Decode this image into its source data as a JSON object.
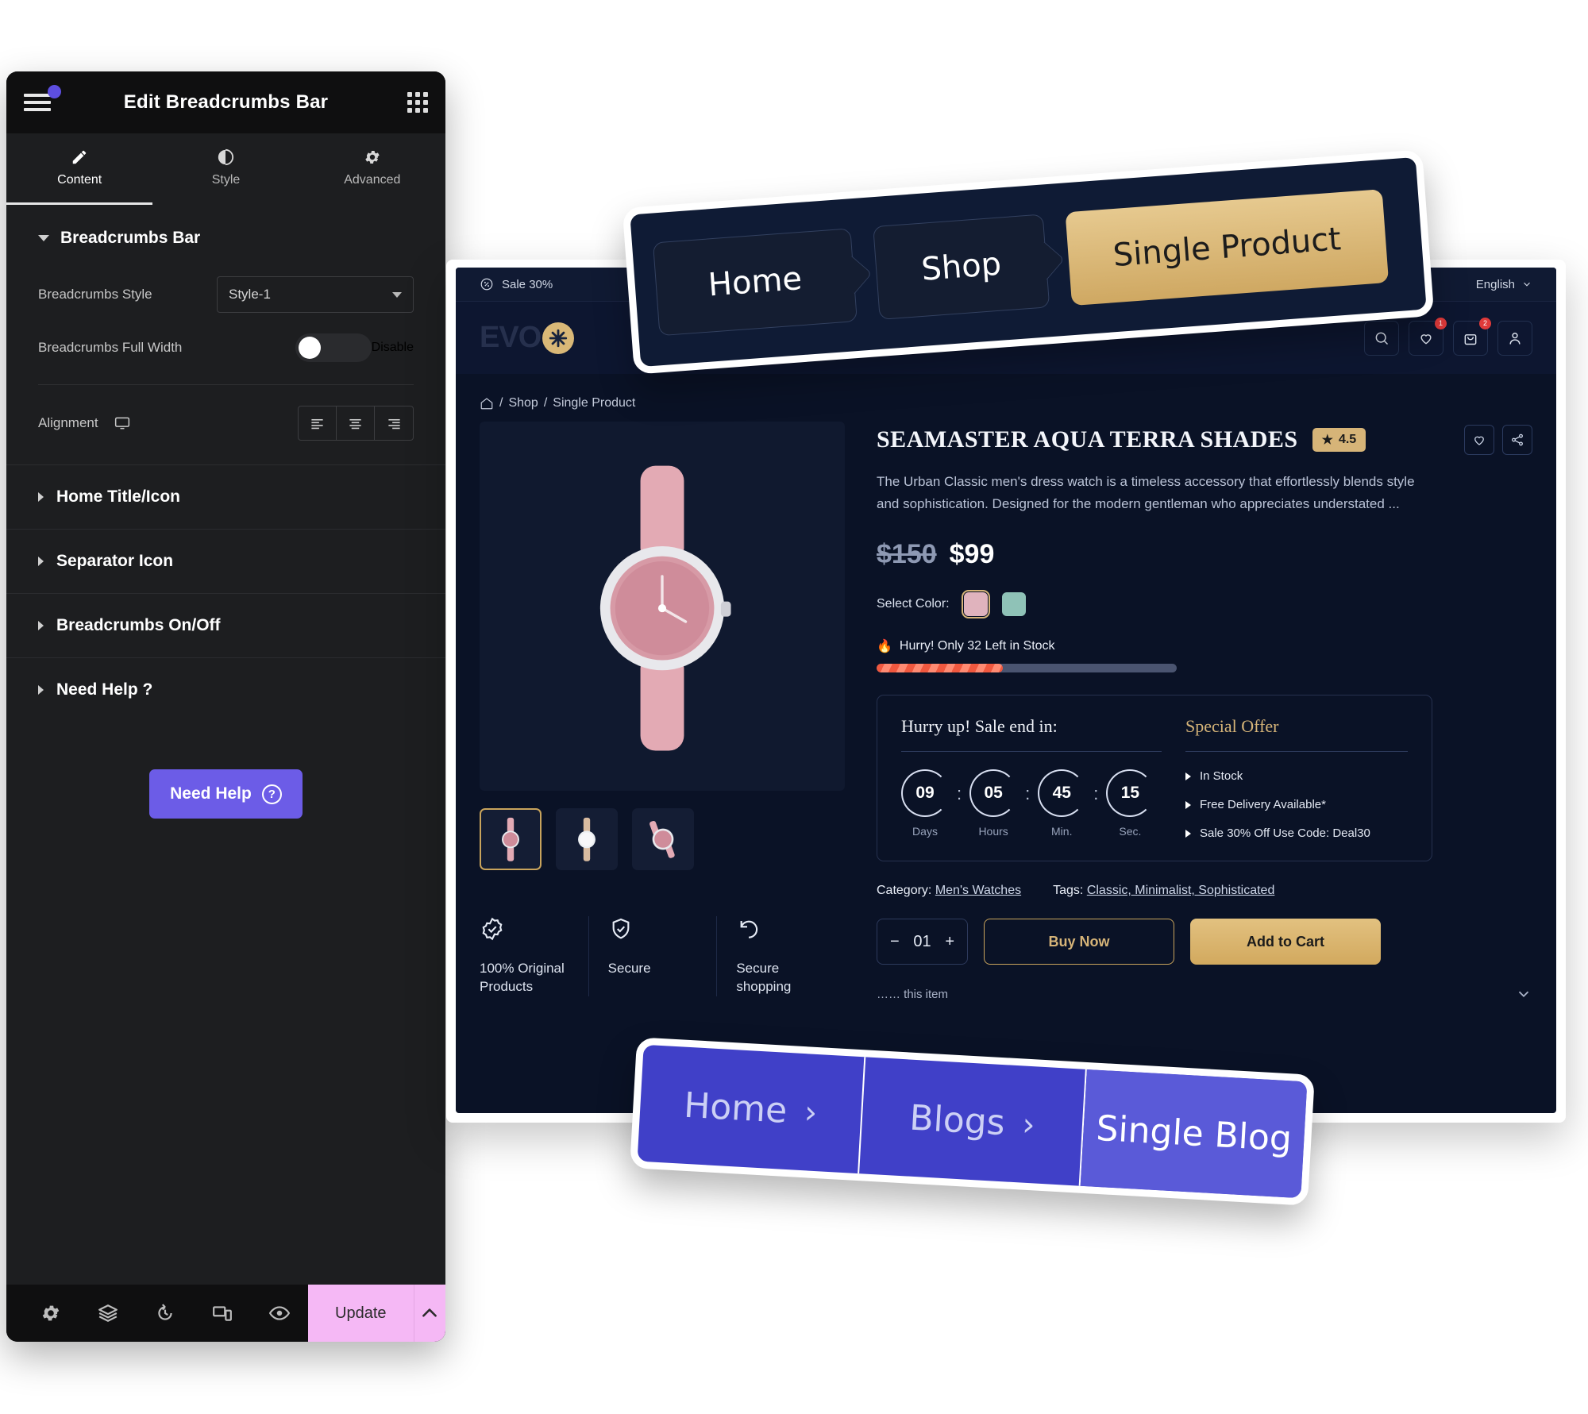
{
  "panel": {
    "title": "Edit Breadcrumbs Bar",
    "menu_icon": "hamburger-icon",
    "apps_icon": "grid-apps-icon",
    "tabs": [
      {
        "label": "Content",
        "icon": "pencil-icon",
        "active": true
      },
      {
        "label": "Style",
        "icon": "contrast-icon",
        "active": false
      },
      {
        "label": "Advanced",
        "icon": "gear-icon",
        "active": false
      }
    ],
    "section": {
      "title": "Breadcrumbs Bar",
      "expanded": true
    },
    "controls": {
      "style_label": "Breadcrumbs Style",
      "style_value": "Style-1",
      "style_options": [
        "Style-1"
      ],
      "full_width_label": "Breadcrumbs Full Width",
      "full_width_state": "Disable",
      "alignment_label": "Alignment",
      "alignment_device": "desktop-monitor-icon",
      "alignment_options": [
        "align-left",
        "align-center",
        "align-right"
      ]
    },
    "accordions": [
      {
        "label": "Home Title/Icon"
      },
      {
        "label": "Separator Icon"
      },
      {
        "label": "Breadcrumbs On/Off"
      },
      {
        "label": "Need Help ?"
      }
    ],
    "help_button": {
      "label": "Need Help",
      "icon": "question-circle-icon"
    },
    "footer": {
      "icons": [
        "gear-icon",
        "layers-icon",
        "history-icon",
        "responsive-icon",
        "eye-icon"
      ],
      "update_label": "Update",
      "update_arrow": "chevron-up-icon"
    }
  },
  "site": {
    "topbar": {
      "icon": "percent-badge-icon",
      "promo": "Sale 30%",
      "language": "English",
      "lang_caret": "chevron-down-icon"
    },
    "header": {
      "logo_text": "EVO",
      "logo_icon": "asterisk-star-icon",
      "icons": [
        {
          "name": "search-icon",
          "badge": ""
        },
        {
          "name": "heart-icon",
          "badge": "1"
        },
        {
          "name": "bag-icon",
          "badge": "2"
        },
        {
          "name": "user-icon",
          "badge": ""
        }
      ]
    },
    "breadcrumb": {
      "home_icon": "home-icon",
      "items": [
        "Shop",
        "Single Product"
      ],
      "separator": "/"
    },
    "product": {
      "title": "SEAMASTER AQUA TERRA SHADES",
      "rating": "4.5",
      "rating_star": "star-icon",
      "wishlist_icon": "heart-icon",
      "share_icon": "share-icon",
      "description": "The Urban Classic men's dress watch is a timeless accessory that effortlessly blends style and sophistication. Designed for the modern gentleman who appreciates understated ...",
      "old_price": "$150",
      "new_price": "$99",
      "color_label": "Select Color:",
      "colors": [
        {
          "hex": "#e0b3bd",
          "selected": true
        },
        {
          "hex": "#8fc2b7",
          "selected": false
        }
      ],
      "stock_icon": "fire-icon",
      "stock_text": "Hurry! Only 32 Left in Stock",
      "stock_percent": 42,
      "countdown": {
        "heading": "Hurry up! Sale end in:",
        "units": [
          {
            "value": "09",
            "label": "Days"
          },
          {
            "value": "05",
            "label": "Hours"
          },
          {
            "value": "45",
            "label": "Min."
          },
          {
            "value": "15",
            "label": "Sec."
          }
        ],
        "separator": ":"
      },
      "special_offer": {
        "heading": "Special Offer",
        "items": [
          "In Stock",
          "Free Delivery Available*",
          "Sale 30% Off Use Code: Deal30"
        ]
      },
      "category_label": "Category:",
      "category_value": "Men's Watches",
      "tags_label": "Tags:",
      "tags_value": "Classic, Minimalist, Sophisticated",
      "quantity": "01",
      "minus": "−",
      "plus": "+",
      "buy_label": "Buy Now",
      "cart_label": "Add to Cart",
      "bottom_note": "…… this item",
      "bottom_chevron": "chevron-down-icon"
    },
    "trust": [
      {
        "icon": "verified-badge-icon",
        "text": "100% Original Products"
      },
      {
        "icon": "shield-check-icon",
        "text": "Secure"
      },
      {
        "icon": "return-arrow-icon",
        "text": "Secure shopping"
      }
    ],
    "thumbnails": [
      {
        "name": "watch-thumb-1",
        "selected": true
      },
      {
        "name": "watch-thumb-2",
        "selected": false
      },
      {
        "name": "watch-thumb-3",
        "selected": false
      }
    ]
  },
  "float_top": {
    "items": [
      {
        "label": "Home",
        "active": false
      },
      {
        "label": "Shop",
        "active": false
      },
      {
        "label": "Single Product",
        "active": true
      }
    ],
    "bg": "#0f1b35",
    "active_bg": "#dcbb80"
  },
  "float_bottom": {
    "items": [
      {
        "label": "Home",
        "chevron": "›",
        "active": false
      },
      {
        "label": "Blogs",
        "chevron": "›",
        "active": false
      },
      {
        "label": "Single Blog",
        "chevron": "",
        "active": true
      }
    ],
    "bg": "#4040c8",
    "active_bg": "#5a5ad8"
  }
}
